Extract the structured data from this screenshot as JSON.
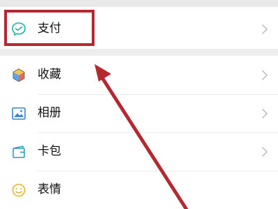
{
  "menu": {
    "pay": {
      "label": "支付",
      "icon": "wallet-icon"
    },
    "items": [
      {
        "label": "收藏",
        "icon": "favorites-cube-icon"
      },
      {
        "label": "相册",
        "icon": "album-icon"
      },
      {
        "label": "卡包",
        "icon": "card-wallet-icon"
      },
      {
        "label": "表情",
        "icon": "emoji-icon"
      }
    ]
  },
  "annotation": {
    "color": "#b6282f",
    "style": "red box highlighting 支付 with red arrow pointing to it"
  },
  "colors": {
    "background": "#ededed",
    "card": "#ffffff",
    "accent_icon": "#1fb0a4"
  }
}
